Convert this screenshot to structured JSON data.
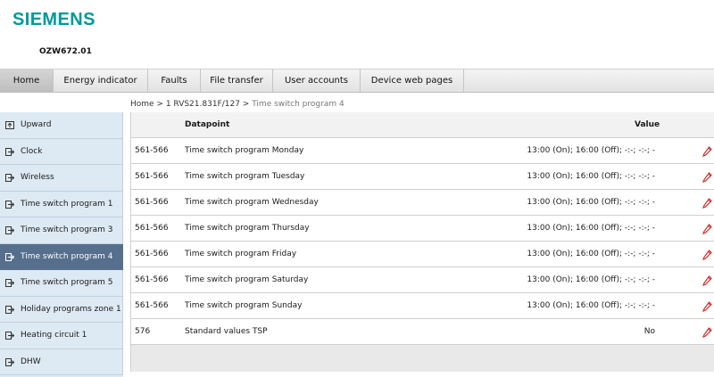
{
  "brand": {
    "logo": "SIEMENS",
    "device": "OZW672.01",
    "accent": "#009999"
  },
  "nav": {
    "tabs": [
      {
        "label": "Home",
        "width": 60,
        "active": true
      },
      {
        "label": "Energy indicator",
        "width": 106
      },
      {
        "label": "Faults",
        "width": 59
      },
      {
        "label": "File transfer",
        "width": 81
      },
      {
        "label": "User accounts",
        "width": 98
      },
      {
        "label": "Device web pages",
        "width": 116
      }
    ]
  },
  "breadcrumb": {
    "path": "Home > 1 RVS21.831F/127 > ",
    "current": "Time switch program 4"
  },
  "sidebar": {
    "items": [
      {
        "label": "Upward",
        "icon": "upward-icon"
      },
      {
        "label": "Clock",
        "icon": "enter-icon"
      },
      {
        "label": "Wireless",
        "icon": "enter-icon"
      },
      {
        "label": "Time switch program 1",
        "icon": "enter-icon"
      },
      {
        "label": "Time switch program 3",
        "icon": "enter-icon"
      },
      {
        "label": "Time switch program 4",
        "icon": "enter-icon",
        "active": true
      },
      {
        "label": "Time switch program 5",
        "icon": "enter-icon"
      },
      {
        "label": "Holiday programs zone 1",
        "icon": "enter-icon"
      },
      {
        "label": "Heating circuit 1",
        "icon": "enter-icon"
      },
      {
        "label": "DHW",
        "icon": "enter-icon"
      }
    ]
  },
  "table": {
    "headers": {
      "datapoint": "Datapoint",
      "value": "Value"
    },
    "rows": [
      {
        "id": "561-566",
        "datapoint": "Time switch program Monday",
        "value": "13:00 (On); 16:00 (Off); -:-; -:-; -"
      },
      {
        "id": "561-566",
        "datapoint": "Time switch program Tuesday",
        "value": "13:00 (On); 16:00 (Off); -:-; -:-; -"
      },
      {
        "id": "561-566",
        "datapoint": "Time switch program Wednesday",
        "value": "13:00 (On); 16:00 (Off); -:-; -:-; -"
      },
      {
        "id": "561-566",
        "datapoint": "Time switch program Thursday",
        "value": "13:00 (On); 16:00 (Off); -:-; -:-; -"
      },
      {
        "id": "561-566",
        "datapoint": "Time switch program Friday",
        "value": "13:00 (On); 16:00 (Off); -:-; -:-; -"
      },
      {
        "id": "561-566",
        "datapoint": "Time switch program Saturday",
        "value": "13:00 (On); 16:00 (Off); -:-; -:-; -"
      },
      {
        "id": "561-566",
        "datapoint": "Time switch program Sunday",
        "value": "13:00 (On); 16:00 (Off); -:-; -:-; -"
      },
      {
        "id": "576",
        "datapoint": "Standard values TSP",
        "value": "No"
      }
    ],
    "edit_icon": "pencil-icon"
  }
}
